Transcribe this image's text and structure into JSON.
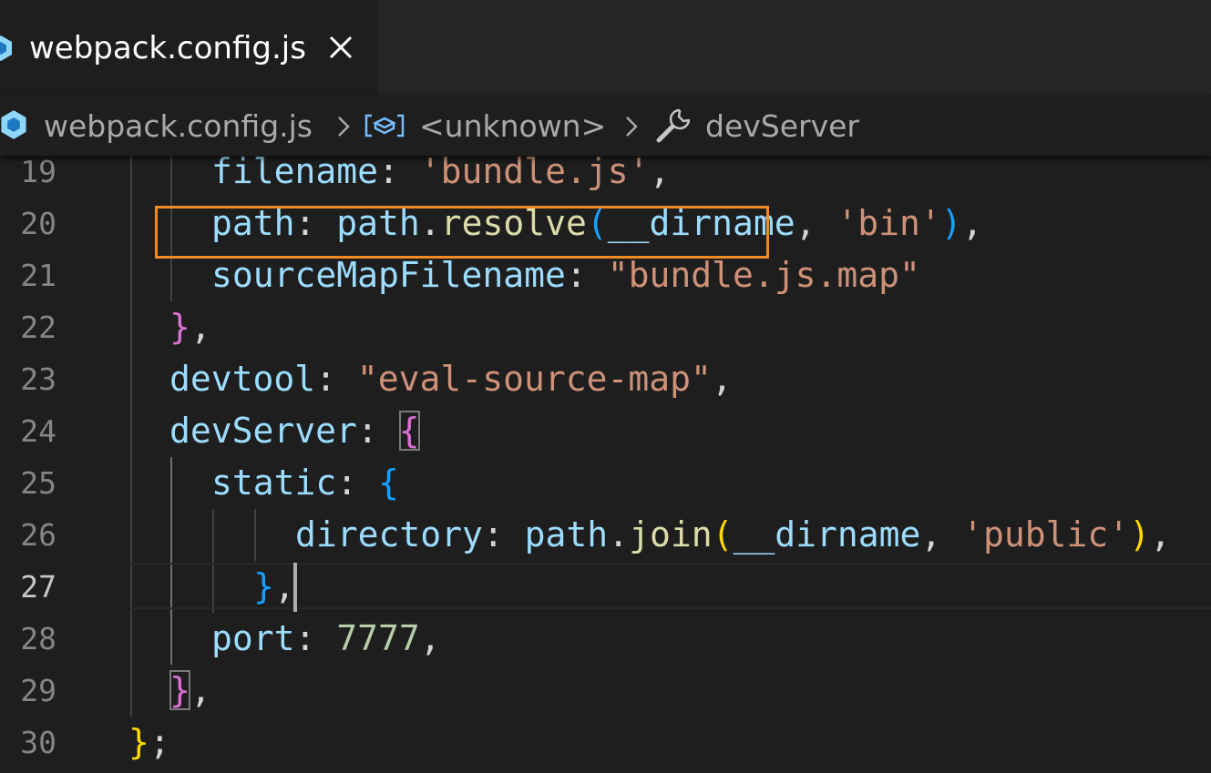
{
  "tab": {
    "title": "webpack.config.js",
    "icon": "webpack-icon",
    "close_icon": "close-icon"
  },
  "breadcrumb": {
    "file": "webpack.config.js",
    "symbol": "<unknown>",
    "member": "devServer",
    "icons": [
      "webpack-icon",
      "variable-icon",
      "wrench-icon"
    ]
  },
  "editor": {
    "current_line": 27,
    "highlighted_line": 23,
    "highlight_color": "#f28a23",
    "lines": [
      {
        "num": "19",
        "tokens": [
          {
            "t": "filename",
            "c": "prop"
          },
          {
            "t": ": ",
            "c": "pl"
          },
          {
            "t": "'bundle.js'",
            "c": "str"
          },
          {
            "t": ",",
            "c": "pl"
          }
        ]
      },
      {
        "num": "20",
        "tokens": [
          {
            "t": "path",
            "c": "prop"
          },
          {
            "t": ": ",
            "c": "pl"
          },
          {
            "t": "path",
            "c": "prop"
          },
          {
            "t": ".",
            "c": "pl"
          },
          {
            "t": "resolve",
            "c": "fn"
          },
          {
            "t": "(",
            "c": "b3"
          },
          {
            "t": "__dirname",
            "c": "prop"
          },
          {
            "t": ", ",
            "c": "pl"
          },
          {
            "t": "'bin'",
            "c": "str"
          },
          {
            "t": ")",
            "c": "b3"
          },
          {
            "t": ",",
            "c": "pl"
          }
        ]
      },
      {
        "num": "21",
        "tokens": [
          {
            "t": "sourceMapFilename",
            "c": "prop"
          },
          {
            "t": ": ",
            "c": "pl"
          },
          {
            "t": "\"bundle.js.map\"",
            "c": "str"
          }
        ]
      },
      {
        "num": "22",
        "tokens": [
          {
            "t": "}",
            "c": "b2"
          },
          {
            "t": ",",
            "c": "pl"
          }
        ]
      },
      {
        "num": "23",
        "tokens": [
          {
            "t": "devtool",
            "c": "prop"
          },
          {
            "t": ": ",
            "c": "pl"
          },
          {
            "t": "\"eval-source-map\"",
            "c": "str"
          },
          {
            "t": ",",
            "c": "pl"
          }
        ]
      },
      {
        "num": "24",
        "tokens": [
          {
            "t": "devServer",
            "c": "prop"
          },
          {
            "t": ": ",
            "c": "pl"
          },
          {
            "t": "{",
            "c": "b2",
            "m": true
          }
        ]
      },
      {
        "num": "25",
        "tokens": [
          {
            "t": "static",
            "c": "prop"
          },
          {
            "t": ": ",
            "c": "pl"
          },
          {
            "t": "{",
            "c": "b3"
          }
        ]
      },
      {
        "num": "26",
        "tokens": [
          {
            "t": "directory",
            "c": "prop"
          },
          {
            "t": ": ",
            "c": "pl"
          },
          {
            "t": "path",
            "c": "prop"
          },
          {
            "t": ".",
            "c": "pl"
          },
          {
            "t": "join",
            "c": "fn"
          },
          {
            "t": "(",
            "c": "b1"
          },
          {
            "t": "__dirname",
            "c": "prop"
          },
          {
            "t": ", ",
            "c": "pl"
          },
          {
            "t": "'public'",
            "c": "str"
          },
          {
            "t": ")",
            "c": "b1"
          },
          {
            "t": ",",
            "c": "pl"
          }
        ]
      },
      {
        "num": "27",
        "tokens": [
          {
            "t": "}",
            "c": "b3"
          },
          {
            "t": ",",
            "c": "pl"
          }
        ]
      },
      {
        "num": "28",
        "tokens": [
          {
            "t": "port",
            "c": "prop"
          },
          {
            "t": ": ",
            "c": "pl"
          },
          {
            "t": "7777",
            "c": "num"
          },
          {
            "t": ",",
            "c": "pl"
          }
        ]
      },
      {
        "num": "29",
        "tokens": [
          {
            "t": "}",
            "c": "b2",
            "m": true
          },
          {
            "t": ",",
            "c": "pl"
          }
        ]
      },
      {
        "num": "30",
        "tokens": [
          {
            "t": "}",
            "c": "b1"
          },
          {
            "t": ";",
            "c": "pl"
          }
        ]
      }
    ]
  }
}
